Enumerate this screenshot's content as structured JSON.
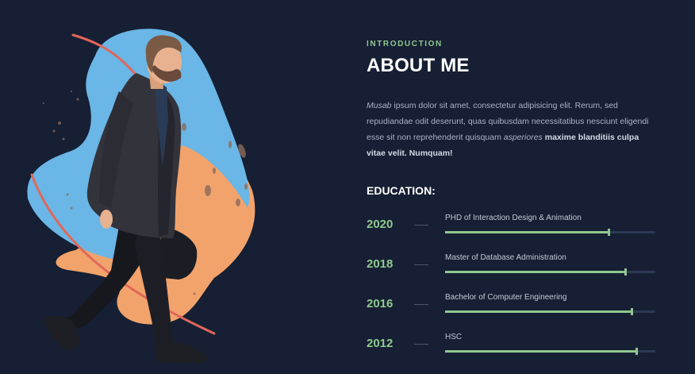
{
  "illustration": {
    "icon": "walking-man-illustration"
  },
  "intro": {
    "eyebrow": "INTRODUCTION",
    "title": "ABOUT ME",
    "bio_name": "Musab",
    "bio_text_1": " ipsum dolor sit amet, consectetur adipisicing elit. Rerum, sed repudiandae odit deserunt, quas quibusdam necessitatibus nesciunt eligendi esse sit non reprehenderit quisquam ",
    "bio_italic": "asperiores",
    "bio_bold": " maxime blanditiis culpa vitae velit. Numquam!"
  },
  "education": {
    "heading": "EDUCATION:",
    "items": [
      {
        "year": "2020",
        "label": "PHD of Interaction Design & Animation",
        "progress": 0.78
      },
      {
        "year": "2018",
        "label": "Master of Database Administration",
        "progress": 0.86
      },
      {
        "year": "2016",
        "label": "Bachelor of Computer Engineering",
        "progress": 0.89
      },
      {
        "year": "2012",
        "label": "HSC",
        "progress": 0.91
      }
    ]
  },
  "colors": {
    "background": "#161f33",
    "accent": "#8fc98f",
    "blob_blue": "#6ab6e6",
    "blob_orange": "#f2a36b",
    "line_red": "#e0675a"
  }
}
